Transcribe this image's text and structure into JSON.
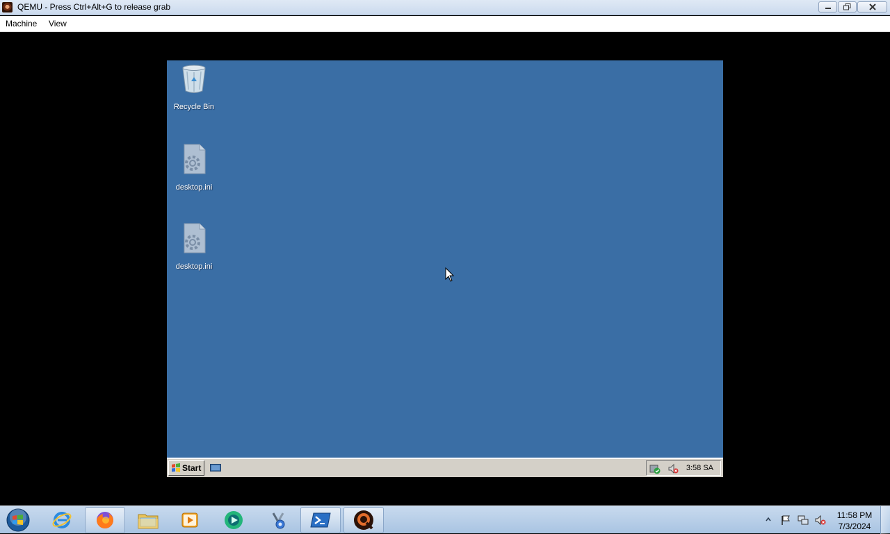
{
  "window": {
    "title": "QEMU - Press Ctrl+Alt+G to release grab",
    "menu": [
      "Machine",
      "View"
    ]
  },
  "guest": {
    "desktop_icons": [
      {
        "label": "Recycle Bin",
        "icon": "recycle-bin-icon"
      },
      {
        "label": "desktop.ini",
        "icon": "settings-file-icon"
      },
      {
        "label": "desktop.ini",
        "icon": "settings-file-icon"
      }
    ],
    "taskbar": {
      "start_label": "Start",
      "clock": "3:58 SA"
    },
    "colors": {
      "desktop": "#3a6ea5",
      "taskbar": "#d4d0c8"
    }
  },
  "host_taskbar": {
    "apps": [
      {
        "name": "internet-explorer-icon",
        "open": false
      },
      {
        "name": "firefox-icon",
        "open": true
      },
      {
        "name": "file-explorer-icon",
        "open": false
      },
      {
        "name": "media-player-icon",
        "open": false
      },
      {
        "name": "app-green-icon",
        "open": false
      },
      {
        "name": "tools-icon",
        "open": false
      },
      {
        "name": "powershell-icon",
        "open": true
      },
      {
        "name": "qemu-icon",
        "open": true
      }
    ],
    "clock": {
      "time": "11:58 PM",
      "date": "7/3/2024"
    }
  }
}
